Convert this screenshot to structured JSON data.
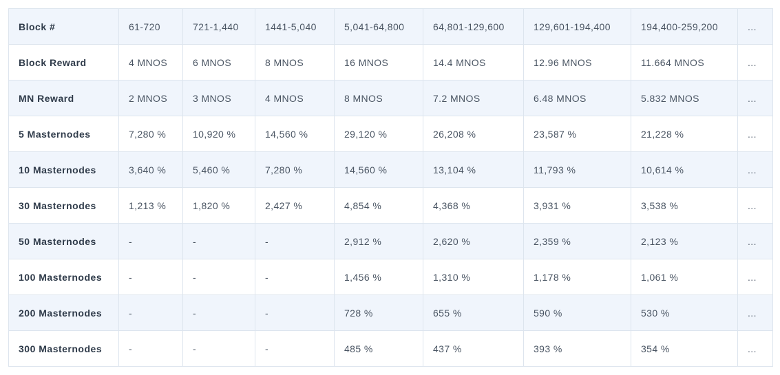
{
  "table": {
    "header_label": "Block #",
    "columns": [
      "61-720",
      "721-1,440",
      "1441-5,040",
      "5,041-64,800",
      "64,801-129,600",
      "129,601-194,400",
      "194,400-259,200",
      "..."
    ],
    "rows": [
      {
        "label": "Block Reward",
        "cells": [
          "4 MNOS",
          "6 MNOS",
          "8 MNOS",
          "16 MNOS",
          "14.4 MNOS",
          "12.96 MNOS",
          "11.664 MNOS",
          "..."
        ]
      },
      {
        "label": "MN Reward",
        "cells": [
          "2 MNOS",
          "3 MNOS",
          "4 MNOS",
          "8 MNOS",
          "7.2 MNOS",
          "6.48 MNOS",
          "5.832 MNOS",
          "..."
        ]
      },
      {
        "label": "5 Masternodes",
        "cells": [
          "7,280 %",
          "10,920 %",
          "14,560 %",
          "29,120 %",
          "26,208 %",
          "23,587 %",
          "21,228 %",
          "..."
        ]
      },
      {
        "label": "10 Masternodes",
        "cells": [
          "3,640 %",
          "5,460 %",
          "7,280 %",
          "14,560 %",
          "13,104 %",
          "11,793 %",
          "10,614 %",
          "..."
        ]
      },
      {
        "label": "30 Masternodes",
        "cells": [
          "1,213 %",
          "1,820 %",
          "2,427 %",
          "4,854 %",
          "4,368 %",
          "3,931 %",
          "3,538 %",
          "..."
        ]
      },
      {
        "label": "50 Masternodes",
        "cells": [
          "-",
          "-",
          "-",
          "2,912 %",
          "2,620 %",
          "2,359 %",
          "2,123 %",
          "..."
        ]
      },
      {
        "label": "100 Masternodes",
        "cells": [
          "-",
          "-",
          "-",
          "1,456 %",
          "1,310 %",
          "1,178 %",
          "1,061 %",
          "..."
        ]
      },
      {
        "label": "200 Masternodes",
        "cells": [
          "-",
          "-",
          "-",
          "728 %",
          "655 %",
          "590 %",
          "530 %",
          "..."
        ]
      },
      {
        "label": "300 Masternodes",
        "cells": [
          "-",
          "-",
          "-",
          "485 %",
          "437 %",
          "393 %",
          "354 %",
          "..."
        ]
      }
    ]
  },
  "colors": {
    "row_stripe": "#f0f5fc",
    "border": "#dde5ee",
    "header_text": "#2f3b4a",
    "cell_text": "#4a5563"
  }
}
